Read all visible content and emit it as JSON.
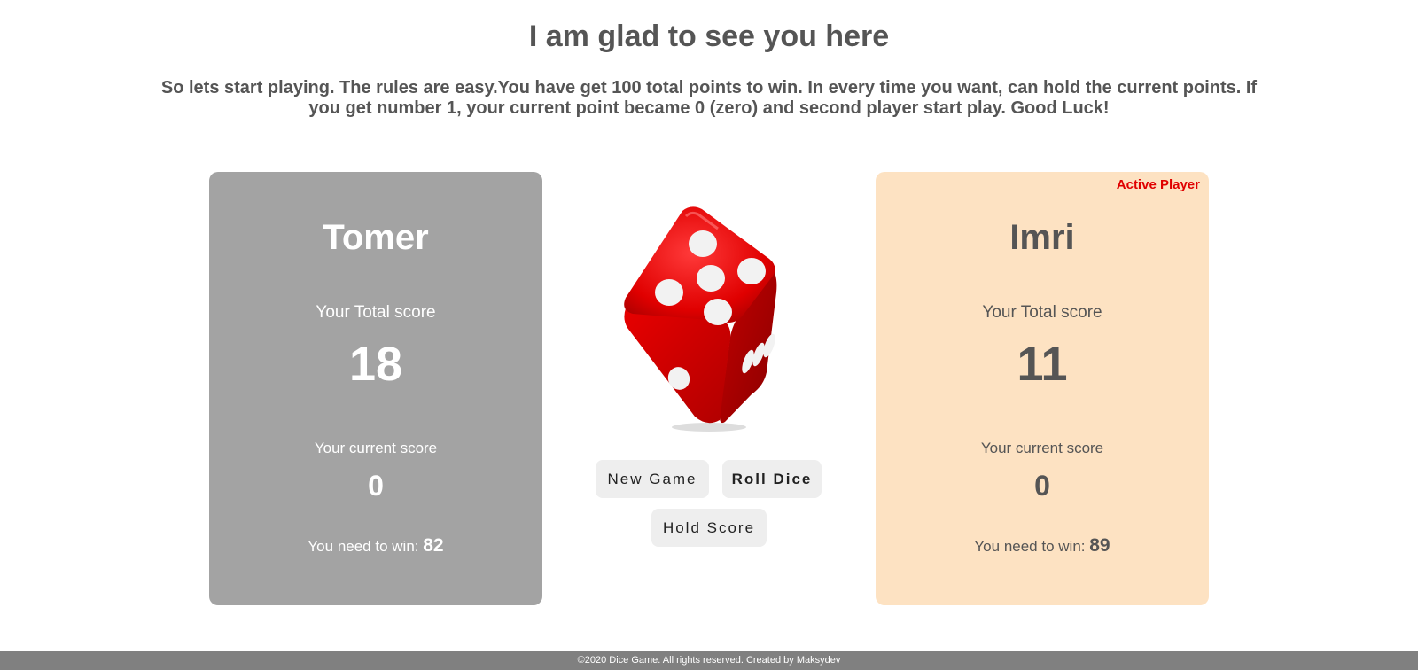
{
  "page": {
    "title": "I am glad to see you here",
    "intro": "So lets start playing. The rules are easy.You have get 100 total points to win. In every time you want, can hold the current points. If you get number 1, your current point became 0 (zero) and second player start play. Good Luck!"
  },
  "players": [
    {
      "name": "Tomer",
      "total_label": "Your Total score",
      "total_score": "18",
      "current_label": "Your current score",
      "current_score": "0",
      "need_label": "You need to win:",
      "need_value": "82",
      "active": false,
      "panel_color": "#a3a3a3"
    },
    {
      "name": "Imri",
      "total_label": "Your Total score",
      "total_score": "11",
      "current_label": "Your current score",
      "current_score": "0",
      "need_label": "You need to win:",
      "need_value": "89",
      "active": true,
      "active_label": "Active Player",
      "panel_color": "#fde2c2"
    }
  ],
  "dice": {
    "icon": "red-dice-icon",
    "color": "#e00000"
  },
  "controls": {
    "new_game": "New Game",
    "roll_dice": "Roll Dice",
    "hold_score": "Hold Score"
  },
  "footer": {
    "text": "©2020  Dice Game. All rights reserved. Created by  Maksydev"
  },
  "colors": {
    "active_badge": "#e00000",
    "footer_bg": "#808080"
  }
}
